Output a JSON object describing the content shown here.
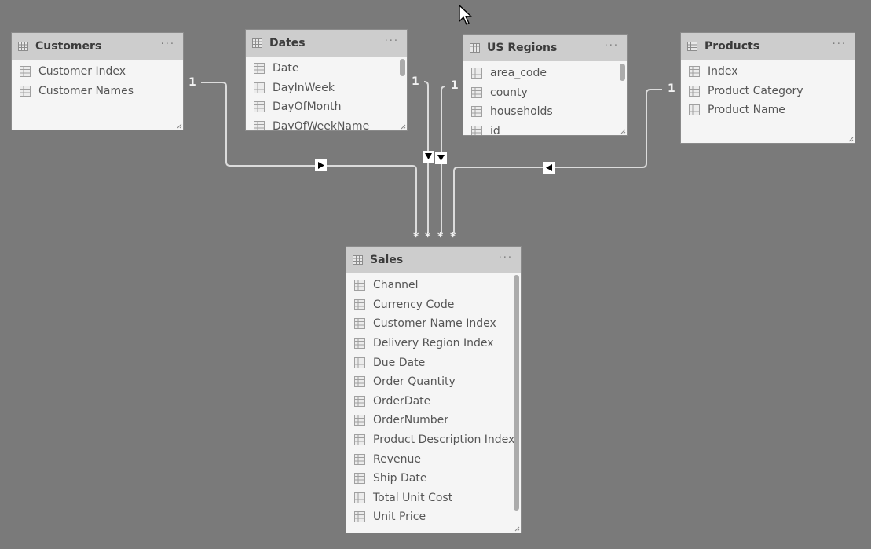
{
  "colors": {
    "canvas_bg": "#7a7a7a",
    "card_header_bg": "#cdcdcd",
    "card_body_bg": "#f5f5f5",
    "relationship_line": "#dcdcdc",
    "text_dark": "#3c3c3c",
    "text_field": "#555555"
  },
  "more_options_label": "···",
  "tables": {
    "customers": {
      "title": "Customers",
      "fields": [
        "Customer Index",
        "Customer Names"
      ]
    },
    "dates": {
      "title": "Dates",
      "fields": [
        "Date",
        "DayInWeek",
        "DayOfMonth",
        "DayOfWeekName"
      ]
    },
    "us_regions": {
      "title": "US Regions",
      "fields": [
        "area_code",
        "county",
        "households",
        "id"
      ]
    },
    "products": {
      "title": "Products",
      "fields": [
        "Index",
        "Product Category",
        "Product Name"
      ]
    },
    "sales": {
      "title": "Sales",
      "fields": [
        "Channel",
        "Currency Code",
        "Customer Name Index",
        "Delivery Region Index",
        "Due Date",
        "Order Quantity",
        "OrderDate",
        "OrderNumber",
        "Product Description Index",
        "Revenue",
        "Ship Date",
        "Total Unit Cost",
        "Unit Price"
      ]
    }
  },
  "relationships": [
    {
      "from": "Customers",
      "to": "Sales",
      "one_label": "1",
      "many_label": "*",
      "direction_icon": "arrow-right"
    },
    {
      "from": "Dates",
      "to": "Sales",
      "one_label": "1",
      "many_label": "*",
      "direction_icon": "arrow-down"
    },
    {
      "from": "US Regions",
      "to": "Sales",
      "one_label": "1",
      "many_label": "*",
      "direction_icon": "arrow-down"
    },
    {
      "from": "Products",
      "to": "Sales",
      "one_label": "1",
      "many_label": "*",
      "direction_icon": "arrow-left"
    }
  ]
}
